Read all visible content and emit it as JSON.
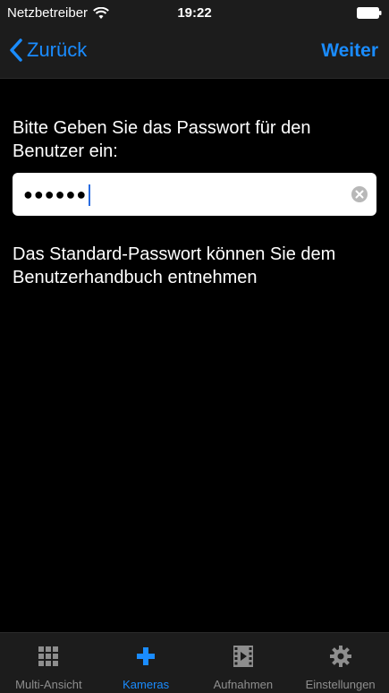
{
  "status_bar": {
    "carrier": "Netzbetreiber",
    "time": "19:22",
    "wifi_icon": "wifi-icon",
    "battery_icon": "battery-icon"
  },
  "nav": {
    "back_label": "Zurück",
    "next_label": "Weiter",
    "accent_color": "#1a8cff"
  },
  "main": {
    "prompt": "Bitte Geben Sie das Passwort für den Benutzer ein:",
    "password_value": "●●●●●●",
    "hint": "Das Standard-Passwort können Sie dem Benutzerhandbuch entnehmen"
  },
  "tabs": [
    {
      "label": "Multi-Ansicht",
      "icon": "grid-icon",
      "active": false
    },
    {
      "label": "Kameras",
      "icon": "plus-icon",
      "active": true
    },
    {
      "label": "Aufnahmen",
      "icon": "film-icon",
      "active": false
    },
    {
      "label": "Einstellungen",
      "icon": "gear-icon",
      "active": false
    }
  ]
}
